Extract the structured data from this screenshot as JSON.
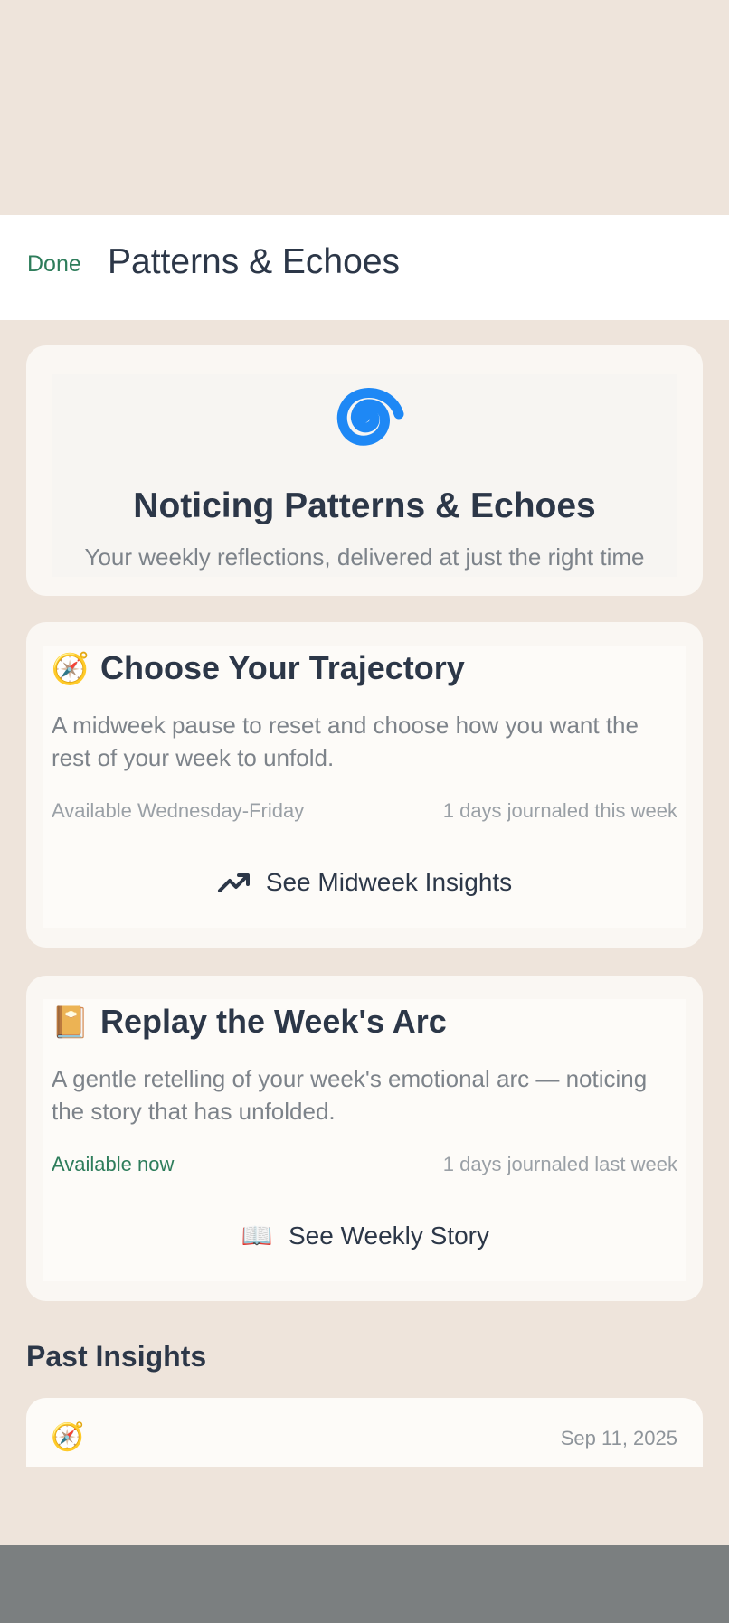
{
  "header": {
    "done_label": "Done",
    "title": "Patterns & Echoes"
  },
  "hero": {
    "icon": "spiral-icon",
    "icon_color": "#1E88F5",
    "title": "Noticing Patterns & Echoes",
    "subtitle": "Your weekly reflections, delivered at just the right time"
  },
  "midweek": {
    "emoji": "🧭",
    "title": "Choose Your Trajectory",
    "description": "A midweek pause to reset and choose how you want the rest of your week to unfold.",
    "availability": "Available Wednesday-Friday",
    "journaled": "1 days journaled this week",
    "button_label": "See Midweek Insights",
    "button_icon": "trending-up-icon"
  },
  "weekly": {
    "emoji": "📔",
    "title": "Replay the Week's Arc",
    "description": "A gentle retelling of your week's emotional arc — noticing the story that has unfolded.",
    "availability": "Available now",
    "journaled": "1 days journaled last week",
    "button_label": "See Weekly Story",
    "button_icon": "📖"
  },
  "past": {
    "section_title": "Past Insights",
    "items": [
      {
        "emoji": "🧭",
        "date": "Sep 11, 2025"
      }
    ]
  },
  "colors": {
    "accent_green": "#2E7D5B",
    "heading": "#2C3748",
    "muted": "#7D838A",
    "background": "#EEE4DB"
  }
}
